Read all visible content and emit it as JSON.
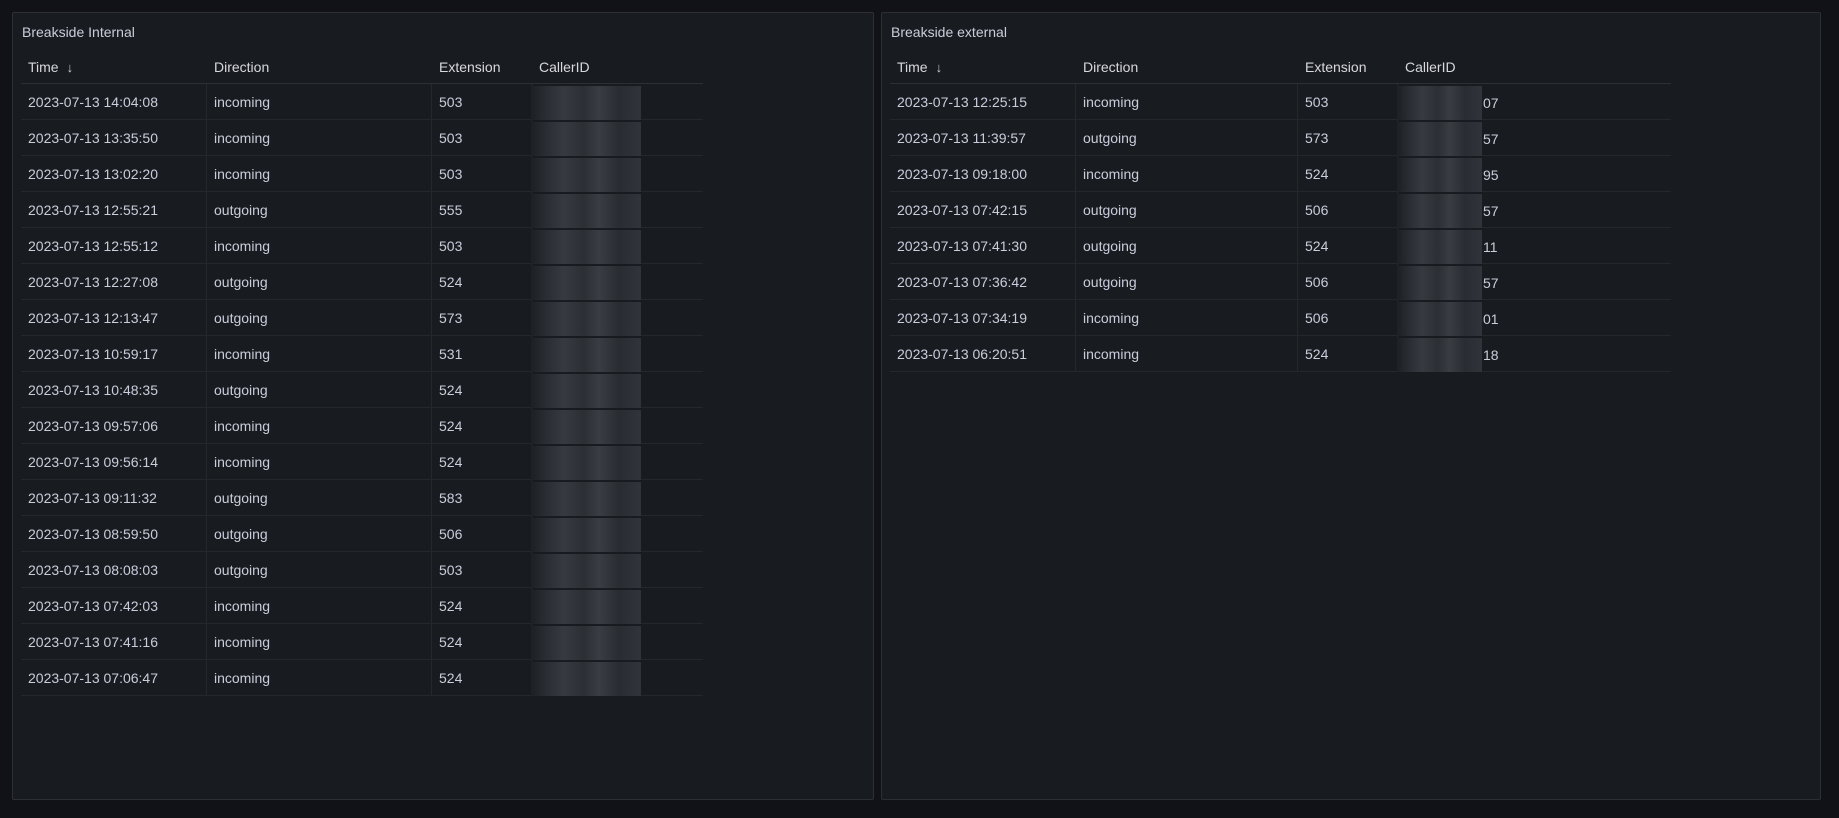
{
  "internal": {
    "title": "Breakside Internal",
    "columns": {
      "time": "Time",
      "direction": "Direction",
      "extension": "Extension",
      "callerid": "CallerID"
    },
    "rows": [
      {
        "time": "2023-07-13 14:04:08",
        "direction": "incoming",
        "extension": "503"
      },
      {
        "time": "2023-07-13 13:35:50",
        "direction": "incoming",
        "extension": "503"
      },
      {
        "time": "2023-07-13 13:02:20",
        "direction": "incoming",
        "extension": "503"
      },
      {
        "time": "2023-07-13 12:55:21",
        "direction": "outgoing",
        "extension": "555"
      },
      {
        "time": "2023-07-13 12:55:12",
        "direction": "incoming",
        "extension": "503"
      },
      {
        "time": "2023-07-13 12:27:08",
        "direction": "outgoing",
        "extension": "524"
      },
      {
        "time": "2023-07-13 12:13:47",
        "direction": "outgoing",
        "extension": "573"
      },
      {
        "time": "2023-07-13 10:59:17",
        "direction": "incoming",
        "extension": "531"
      },
      {
        "time": "2023-07-13 10:48:35",
        "direction": "outgoing",
        "extension": "524"
      },
      {
        "time": "2023-07-13 09:57:06",
        "direction": "incoming",
        "extension": "524"
      },
      {
        "time": "2023-07-13 09:56:14",
        "direction": "incoming",
        "extension": "524"
      },
      {
        "time": "2023-07-13 09:11:32",
        "direction": "outgoing",
        "extension": "583"
      },
      {
        "time": "2023-07-13 08:59:50",
        "direction": "outgoing",
        "extension": "506"
      },
      {
        "time": "2023-07-13 08:08:03",
        "direction": "outgoing",
        "extension": "503"
      },
      {
        "time": "2023-07-13 07:42:03",
        "direction": "incoming",
        "extension": "524"
      },
      {
        "time": "2023-07-13 07:41:16",
        "direction": "incoming",
        "extension": "524"
      },
      {
        "time": "2023-07-13 07:06:47",
        "direction": "incoming",
        "extension": "524"
      }
    ]
  },
  "external": {
    "title": "Breakside external",
    "columns": {
      "time": "Time",
      "direction": "Direction",
      "extension": "Extension",
      "callerid": "CallerID"
    },
    "rows": [
      {
        "time": "2023-07-13 12:25:15",
        "direction": "incoming",
        "extension": "503",
        "callerid_suffix": "07"
      },
      {
        "time": "2023-07-13 11:39:57",
        "direction": "outgoing",
        "extension": "573",
        "callerid_suffix": "57"
      },
      {
        "time": "2023-07-13 09:18:00",
        "direction": "incoming",
        "extension": "524",
        "callerid_suffix": "95"
      },
      {
        "time": "2023-07-13 07:42:15",
        "direction": "outgoing",
        "extension": "506",
        "callerid_suffix": "57"
      },
      {
        "time": "2023-07-13 07:41:30",
        "direction": "outgoing",
        "extension": "524",
        "callerid_suffix": "11"
      },
      {
        "time": "2023-07-13 07:36:42",
        "direction": "outgoing",
        "extension": "506",
        "callerid_suffix": "57"
      },
      {
        "time": "2023-07-13 07:34:19",
        "direction": "incoming",
        "extension": "506",
        "callerid_suffix": "01"
      },
      {
        "time": "2023-07-13 06:20:51",
        "direction": "incoming",
        "extension": "524",
        "callerid_suffix": "18"
      }
    ]
  },
  "icons": {
    "sort": "arrow-down-icon"
  },
  "colors": {
    "background": "#111217",
    "panel": "#181b1f",
    "text": "#ccccdc",
    "border": "#2c2f35"
  }
}
